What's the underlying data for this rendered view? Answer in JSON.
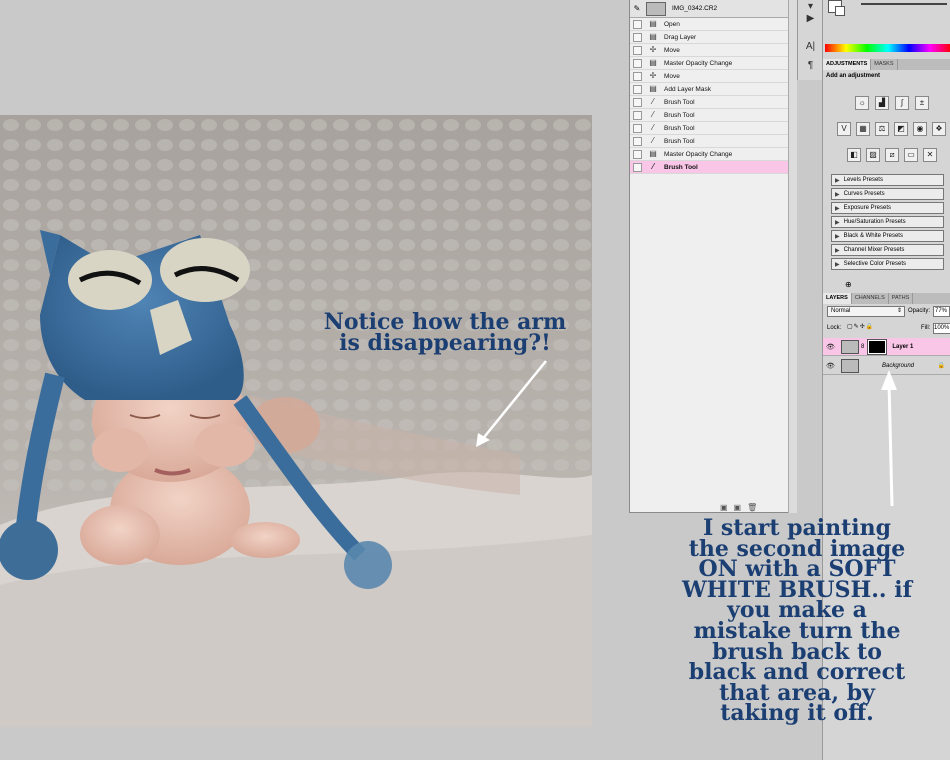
{
  "annotations": {
    "note_arm": [
      "Notice how the arm",
      "is disappearing?!"
    ],
    "note_paint": [
      "I start painting",
      "the second image",
      "ON with a SOFT",
      "WHITE BRUSH.. if",
      "you make a",
      "mistake turn the",
      "brush back to",
      "black and correct",
      "that area, by",
      "taking it off."
    ]
  },
  "history": {
    "snapshot_label": "IMG_0342.CR2",
    "items": [
      {
        "label": "Open",
        "icon": "document-icon"
      },
      {
        "label": "Drag Layer",
        "icon": "document-icon"
      },
      {
        "label": "Move",
        "icon": "move-icon"
      },
      {
        "label": "Master Opacity Change",
        "icon": "document-icon"
      },
      {
        "label": "Move",
        "icon": "move-icon"
      },
      {
        "label": "Add Layer Mask",
        "icon": "document-icon"
      },
      {
        "label": "Brush Tool",
        "icon": "brush-icon"
      },
      {
        "label": "Brush Tool",
        "icon": "brush-icon"
      },
      {
        "label": "Brush Tool",
        "icon": "brush-icon"
      },
      {
        "label": "Brush Tool",
        "icon": "brush-icon"
      },
      {
        "label": "Master Opacity Change",
        "icon": "document-icon"
      },
      {
        "label": "Brush Tool",
        "icon": "brush-icon",
        "selected": true
      }
    ]
  },
  "adjustments": {
    "tabs": [
      "ADJUSTMENTS",
      "MASKS"
    ],
    "heading": "Add an adjustment",
    "presets": [
      "Levels Presets",
      "Curves Presets",
      "Exposure Presets",
      "Hue/Saturation Presets",
      "Black & White Presets",
      "Channel Mixer Presets",
      "Selective Color Presets"
    ]
  },
  "layers": {
    "tabs": [
      "LAYERS",
      "CHANNELS",
      "PATHS"
    ],
    "blend_mode": "Normal",
    "opacity_label": "Opacity:",
    "opacity_value": "77%",
    "lock_label": "Lock:",
    "fill_label": "Fill:",
    "fill_value": "100%",
    "items": [
      {
        "name": "Layer 1",
        "selected": true
      },
      {
        "name": "Background",
        "selected": false
      }
    ]
  },
  "colors": {
    "annotation_text": "#1c3f73",
    "selection_pink": "#f9c6e8"
  }
}
